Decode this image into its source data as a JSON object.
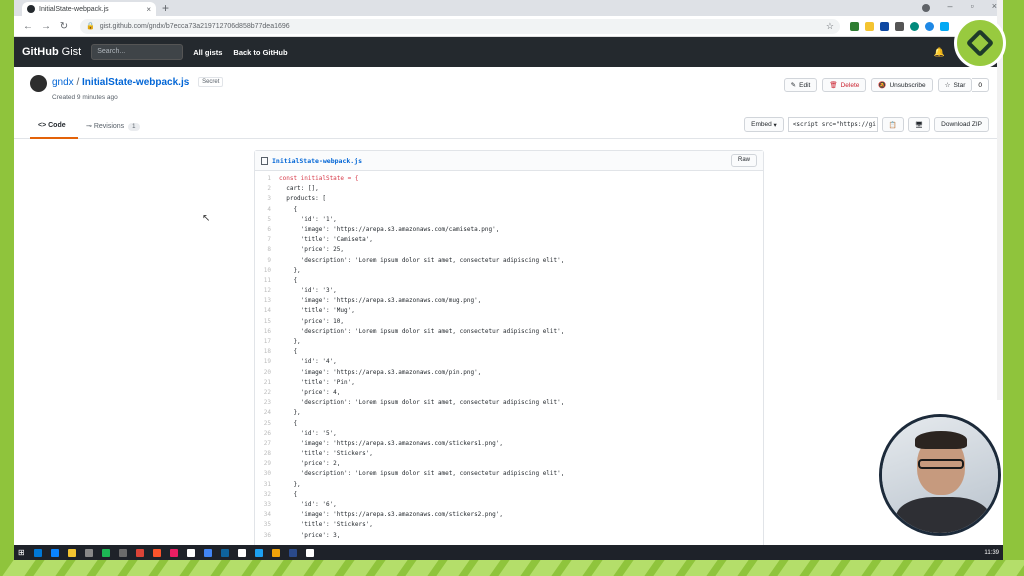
{
  "browser": {
    "tab_title": "InitialState-webpack.js",
    "url": "gist.github.com/gndx/b7ecca73a219712706d858b77dea1696"
  },
  "header": {
    "logo_bold": "GitHub",
    "logo_sub": "Gist",
    "search_placeholder": "Search...",
    "links": [
      "All gists",
      "Back to GitHub"
    ]
  },
  "gist": {
    "owner": "gndx",
    "separator": "/",
    "name": "InitialState-webpack.js",
    "badge": "Secret",
    "created": "Created 9 minutes ago",
    "actions": {
      "edit": "Edit",
      "delete": "Delete",
      "unsubscribe": "Unsubscribe",
      "star": "Star",
      "star_count": "0"
    }
  },
  "tabs": {
    "code": "Code",
    "revisions": "Revisions",
    "revisions_count": "1",
    "embed": "Embed",
    "embed_value": "<script src=\"https://gi",
    "download": "Download ZIP"
  },
  "file": {
    "name": "InitialState-webpack.js",
    "raw": "Raw",
    "lines": [
      "const initialState = {",
      "  cart: [],",
      "  products: [",
      "    {",
      "      'id': '1',",
      "      'image': 'https://arepa.s3.amazonaws.com/camiseta.png',",
      "      'title': 'Camiseta',",
      "      'price': 25,",
      "      'description': 'Lorem ipsum dolor sit amet, consectetur adipiscing elit',",
      "    },",
      "    {",
      "      'id': '3',",
      "      'image': 'https://arepa.s3.amazonaws.com/mug.png',",
      "      'title': 'Mug',",
      "      'price': 10,",
      "      'description': 'Lorem ipsum dolor sit amet, consectetur adipiscing elit',",
      "    },",
      "    {",
      "      'id': '4',",
      "      'image': 'https://arepa.s3.amazonaws.com/pin.png',",
      "      'title': 'Pin',",
      "      'price': 4,",
      "      'description': 'Lorem ipsum dolor sit amet, consectetur adipiscing elit',",
      "    },",
      "    {",
      "      'id': '5',",
      "      'image': 'https://arepa.s3.amazonaws.com/stickers1.png',",
      "      'title': 'Stickers',",
      "      'price': 2,",
      "      'description': 'Lorem ipsum dolor sit amet, consectetur adipiscing elit',",
      "    },",
      "    {",
      "      'id': '6',",
      "      'image': 'https://arepa.s3.amazonaws.com/stickers2.png',",
      "      'title': 'Stickers',",
      "      'price': 3,"
    ]
  },
  "taskbar": {
    "time": "11:39",
    "icon_colors": [
      "#0078d7",
      "#0a84ff",
      "#f4c430",
      "#888888",
      "#1db954",
      "#6b6b6b",
      "#db4437",
      "#fb542b",
      "#e91e63",
      "#ffffff",
      "#4285f4",
      "#0e639c",
      "#ffffff",
      "#1da1f2",
      "#f0a30a",
      "#2a4a8a",
      "#ffffff"
    ]
  },
  "colors": {
    "accent_green": "#8fc43c",
    "github_header": "#24292e",
    "link_blue": "#0366d6",
    "tab_underline": "#e36209"
  }
}
